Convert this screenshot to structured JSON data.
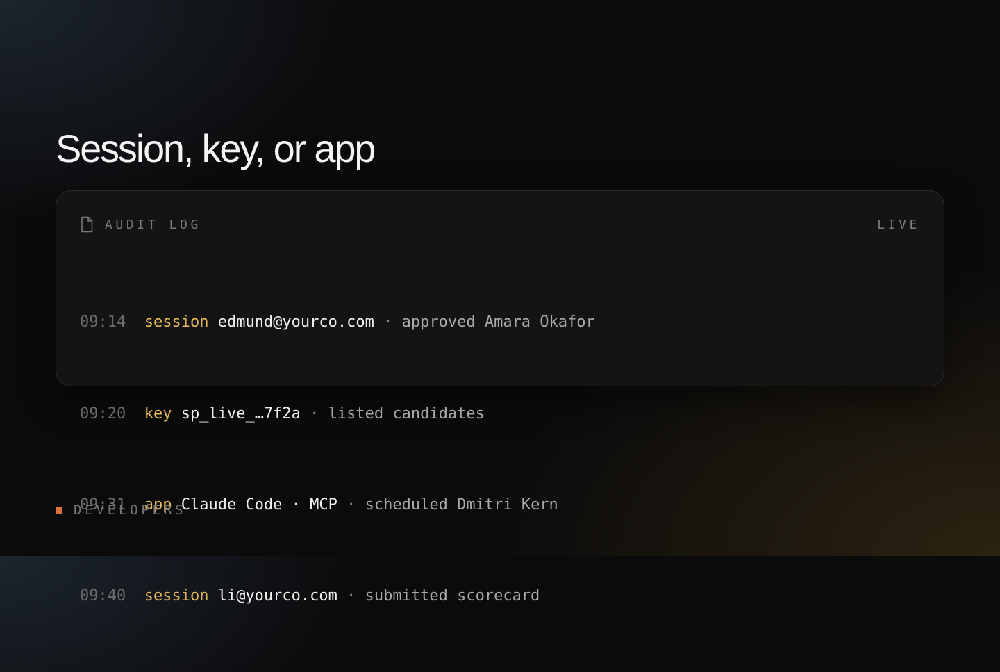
{
  "page": {
    "title": "Session, key, or app"
  },
  "audit_log": {
    "header_label": "AUDIT LOG",
    "header_icon": "document-icon",
    "status_label": "LIVE",
    "separator": "·",
    "entries": [
      {
        "time": "09:14",
        "kind": "session",
        "actor": "edmund@yourco.com",
        "action": "approved Amara Okafor"
      },
      {
        "time": "09:20",
        "kind": "key",
        "actor": "sp_live_…7f2a",
        "action": "listed candidates"
      },
      {
        "time": "09:31",
        "kind": "app",
        "actor": "Claude Code · MCP",
        "action": "scheduled Dmitri Kern"
      },
      {
        "time": "09:40",
        "kind": "session",
        "actor": "li@yourco.com",
        "action": "submitted scorecard"
      }
    ]
  },
  "footer": {
    "label": "DEVELOPERS",
    "marker_icon": "square-icon"
  },
  "colors": {
    "background": "#0b0b0c",
    "card_background": "#141414",
    "card_border": "#2a2a2a",
    "kind_accent": "#e7b85a",
    "footer_marker": "#d9723a"
  }
}
